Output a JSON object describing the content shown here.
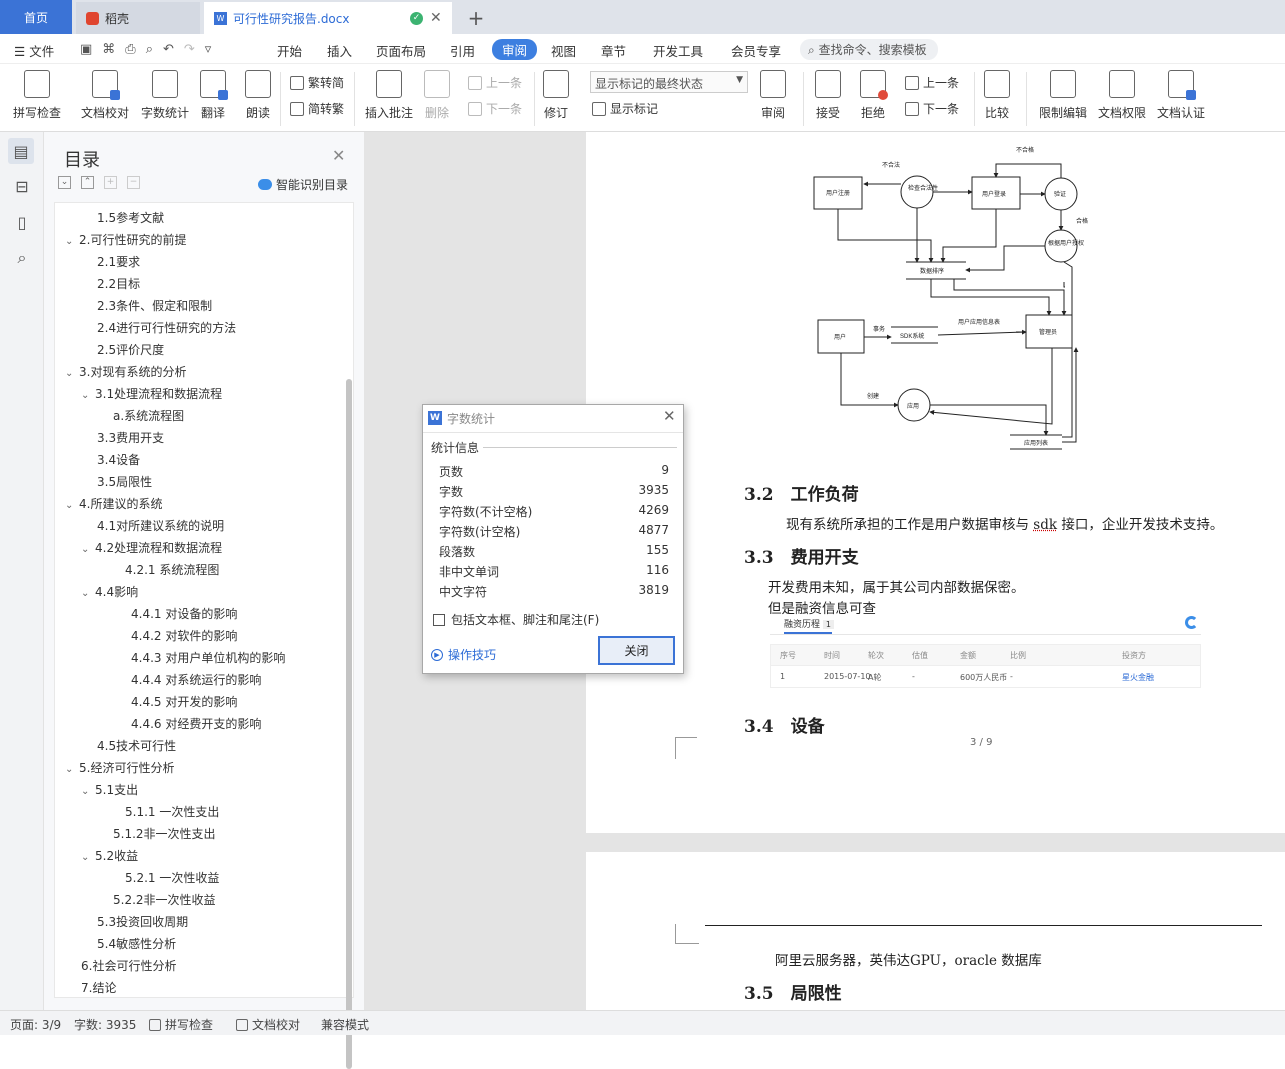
{
  "tabs": {
    "home": "首页",
    "daoke": "稻壳",
    "doc": "可行性研究报告.docx"
  },
  "menu": {
    "file": "文件",
    "items": [
      "开始",
      "插入",
      "页面布局",
      "引用",
      "审阅",
      "视图",
      "章节",
      "开发工具",
      "会员专享"
    ],
    "active": "审阅",
    "search": "查找命令、搜索模板"
  },
  "ribbon": {
    "spell": "拼写检查",
    "proof": "文档校对",
    "wordcount": "字数统计",
    "translate": "翻译",
    "read": "朗读",
    "trad": "繁转简",
    "simp": "简转繁",
    "insert_comment": "插入批注",
    "delete": "删除",
    "prev": "上一条",
    "next": "下一条",
    "track": "修订",
    "markup_state": "显示标记的最终状态",
    "show_markup": "显示标记",
    "review": "审阅",
    "accept": "接受",
    "reject": "拒绝",
    "prev2": "上一条",
    "next2": "下一条",
    "compare": "比较",
    "restrict": "限制编辑",
    "permission": "文档权限",
    "certify": "文档认证"
  },
  "toc": {
    "title": "目录",
    "smart": "智能识别目录",
    "items": [
      {
        "t": "1.5参考文献"
      },
      {
        "t": "2.可行性研究的前提"
      },
      {
        "t": "2.1要求"
      },
      {
        "t": "2.2目标"
      },
      {
        "t": "2.3条件、假定和限制"
      },
      {
        "t": "2.4进行可行性研究的方法"
      },
      {
        "t": "2.5评价尺度"
      },
      {
        "t": "3.对现有系统的分析"
      },
      {
        "t": "3.1处理流程和数据流程"
      },
      {
        "t": "a.系统流程图"
      },
      {
        "t": "3.3费用开支"
      },
      {
        "t": "3.4设备"
      },
      {
        "t": "3.5局限性"
      },
      {
        "t": "4.所建议的系统"
      },
      {
        "t": "4.1对所建议系统的说明"
      },
      {
        "t": "4.2处理流程和数据流程"
      },
      {
        "t": "4.2.1 系统流程图"
      },
      {
        "t": "4.4影响"
      },
      {
        "t": "4.4.1 对设备的影响"
      },
      {
        "t": "4.4.2 对软件的影响"
      },
      {
        "t": "4.4.3 对用户单位机构的影响"
      },
      {
        "t": "4.4.4 对系统运行的影响"
      },
      {
        "t": "4.4.5 对开发的影响"
      },
      {
        "t": "4.4.6 对经费开支的影响"
      },
      {
        "t": "4.5技术可行性"
      },
      {
        "t": "5.经济可行性分析"
      },
      {
        "t": "5.1支出"
      },
      {
        "t": "5.1.1 一次性支出"
      },
      {
        "t": "5.1.2非一次性支出"
      },
      {
        "t": "5.2收益"
      },
      {
        "t": "5.2.1 一次性收益"
      },
      {
        "t": "5.2.2非一次性收益"
      },
      {
        "t": "5.3投资回收周期"
      },
      {
        "t": "5.4敏感性分析"
      },
      {
        "t": "6.社会可行性分析"
      },
      {
        "t": "7.结论"
      }
    ]
  },
  "diagram": {
    "labels": [
      "不合法",
      "不合格",
      "用户注册",
      "检查合法性",
      "用户登录",
      "验证",
      "合格",
      "根据用户授权",
      "数据排序",
      "用户",
      "事务",
      "SDK系统",
      "用户应用信息表",
      "管理员",
      "创建",
      "应用",
      "应用列表"
    ]
  },
  "doc": {
    "h32": "3.2　工作负荷",
    "p32a": "现有系统所承担的工作是用户数据审核与 ",
    "p32sdk": "sdk",
    "p32b": " 接口，企业开发技术支持。",
    "h33": "3.3　费用开支",
    "p33a": "开发费用未知，属于其公司内部数据保密。",
    "p33b": "但是融资信息可查",
    "fin_tab": "融资历程",
    "fin_count": "1",
    "fin_headers": [
      "序号",
      "时间",
      "轮次",
      "估值",
      "金额",
      "比例",
      "投资方"
    ],
    "fin_row": [
      "1",
      "2015-07-10",
      "A轮",
      "-",
      "600万人民币",
      "-",
      "星火金融"
    ],
    "h34": "3.4　设备",
    "page_num": "3 / 9",
    "p2": "阿里云服务器，英伟达GPU，oracle 数据库",
    "h35": "3.5　局限性"
  },
  "dialog": {
    "title": "字数统计",
    "section": "统计信息",
    "rows": [
      [
        "页数",
        "9"
      ],
      [
        "字数",
        "3935"
      ],
      [
        "字符数(不计空格)",
        "4269"
      ],
      [
        "字符数(计空格)",
        "4877"
      ],
      [
        "段落数",
        "155"
      ],
      [
        "非中文单词",
        "116"
      ],
      [
        "中文字符",
        "3819"
      ]
    ],
    "check": "包括文本框、脚注和尾注(F)",
    "tips": "操作技巧",
    "close": "关闭"
  },
  "status": {
    "page": "页面: 3/9",
    "words": "字数: 3935",
    "spell": "拼写检查",
    "proof": "文档校对",
    "compat": "兼容模式"
  }
}
